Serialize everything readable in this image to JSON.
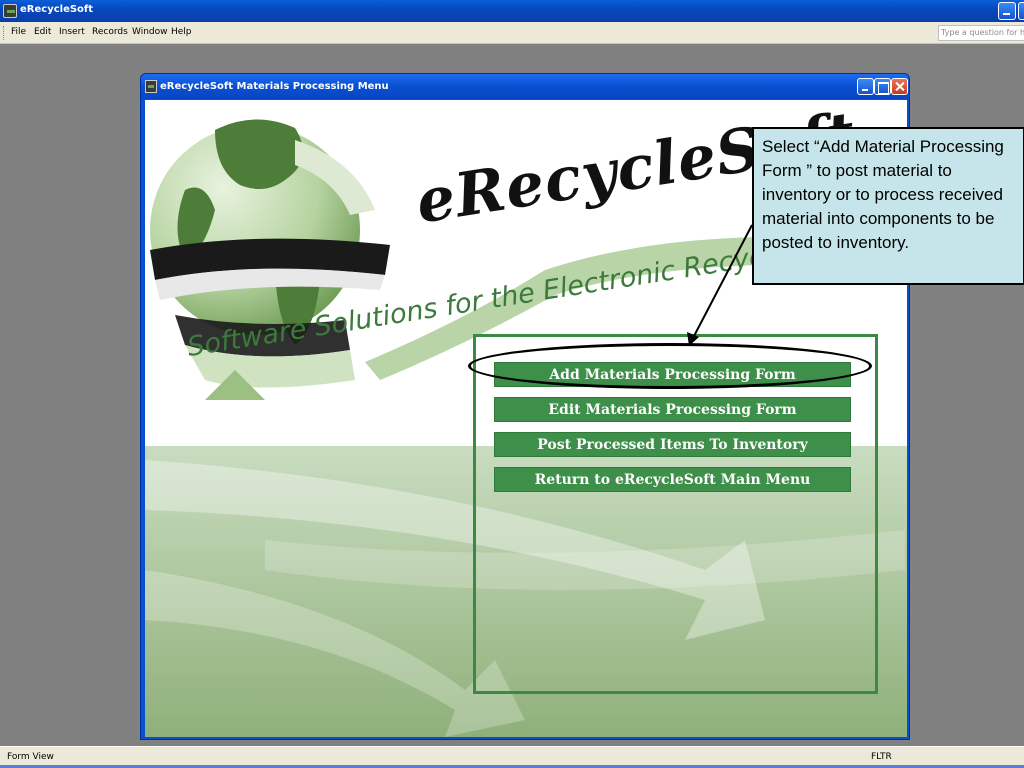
{
  "app": {
    "title": "eRecycleSoft",
    "help_placeholder": "Type a question for help"
  },
  "menubar": {
    "items": [
      "File",
      "Edit",
      "Insert",
      "Records",
      "Window",
      "Help"
    ]
  },
  "form": {
    "title": "eRecycleSoft Materials Processing Menu",
    "logo_text": "eRecycleSoft",
    "tagline": "Software Solutions for the Electronic Recycling Industry",
    "buttons": [
      "Add Materials Processing Form",
      "Edit Materials Processing Form",
      "Post Processed Items To Inventory",
      "Return to eRecycleSoft Main Menu"
    ]
  },
  "callout": {
    "text": "Select “Add Material Processing Form ” to post material to inventory or to process received material into components to be posted to inventory."
  },
  "statusbar": {
    "left": "Form View",
    "right": "FLTR"
  },
  "colors": {
    "accent_green": "#3d8f49",
    "callout_bg": "#c6e5ea",
    "titlebar_blue": "#0a4fd0"
  }
}
